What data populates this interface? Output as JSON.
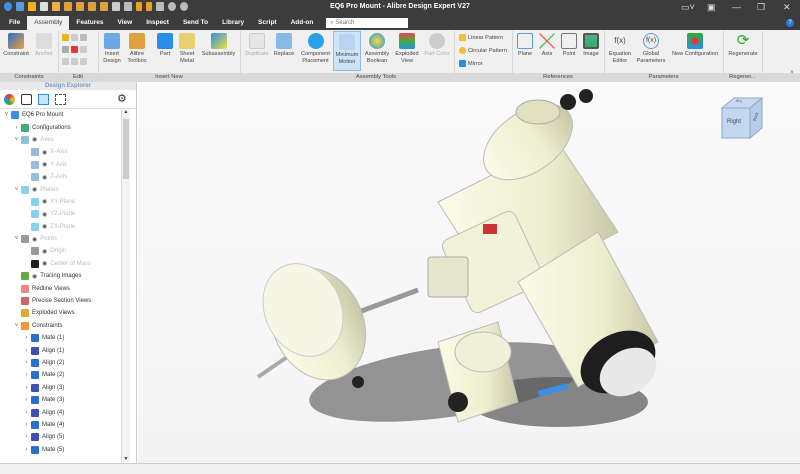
{
  "window": {
    "title": "EQ6 Pro Mount - Alibre Design Expert V27"
  },
  "tabs": [
    "File",
    "Assembly",
    "Features",
    "View",
    "Inspect",
    "Send To",
    "Library",
    "Script",
    "Add-on"
  ],
  "search": {
    "placeholder": "Search"
  },
  "ribbon": {
    "constraints": {
      "constraint": "Constraint",
      "anchor": "Anchor"
    },
    "insert": {
      "insert_design": "Insert Design",
      "alibre_toolbox": "Alibre Toolbox",
      "part": "Part",
      "sheet_metal": "Sheet Metal",
      "subassembly": "Subassembly"
    },
    "tools": {
      "duplicate": "Duplicate",
      "replace": "Replace",
      "component_placement": "Component Placement",
      "minimum_motion": "Minimum Motion",
      "assembly_boolean": "Assembly Boolean",
      "exploded_view": "Exploded View",
      "part_color": "Part Color",
      "linear_pattern": "Linear Pattern",
      "circular_pattern": "Circular Pattern",
      "mirror": "Mirror"
    },
    "references": {
      "plane": "Plane",
      "axis": "Axis",
      "point": "Point",
      "image": "Image"
    },
    "parameters": {
      "equation_editor": "Equation Editor",
      "global_parameters": "Global Parameters",
      "new_configuration": "New Configuration"
    },
    "regenerate": "Regenerate",
    "groups": {
      "constraints": "Constraints",
      "edit": "Edit",
      "insert_new": "Insert New",
      "assembly_tools": "Assembly Tools",
      "references": "References",
      "parameters": "Parameters",
      "regenerate": "Regener..."
    }
  },
  "explorer": {
    "title": "Design Explorer",
    "tree": [
      {
        "label": "EQ6 Pro Mount",
        "level": 0,
        "tw": "v",
        "dim": false,
        "icon": "#3a8ee6",
        "eye": false
      },
      {
        "label": "Configurations",
        "level": 1,
        "tw": ">",
        "dim": false,
        "icon": "#4a7",
        "eye": false
      },
      {
        "label": "Axes",
        "level": 1,
        "tw": "v",
        "dim": true,
        "icon": "#9bd",
        "eye": true
      },
      {
        "label": "X-Axis",
        "level": 2,
        "tw": "",
        "dim": true,
        "icon": "#9bd",
        "eye": true
      },
      {
        "label": "Y-Axis",
        "level": 2,
        "tw": "",
        "dim": true,
        "icon": "#9bd",
        "eye": true
      },
      {
        "label": "Z-Axis",
        "level": 2,
        "tw": "",
        "dim": true,
        "icon": "#9bd",
        "eye": true
      },
      {
        "label": "Planes",
        "level": 1,
        "tw": "v",
        "dim": true,
        "icon": "#8bd0f0",
        "eye": true
      },
      {
        "label": "XY-Plane",
        "level": 2,
        "tw": "",
        "dim": true,
        "icon": "#8bd0f0",
        "eye": true
      },
      {
        "label": "YZ-Plane",
        "level": 2,
        "tw": "",
        "dim": true,
        "icon": "#8bd0f0",
        "eye": true
      },
      {
        "label": "ZX-Plane",
        "level": 2,
        "tw": "",
        "dim": true,
        "icon": "#8bd0f0",
        "eye": true
      },
      {
        "label": "Points",
        "level": 1,
        "tw": "v",
        "dim": true,
        "icon": "#999",
        "eye": true
      },
      {
        "label": "Origin",
        "level": 2,
        "tw": "",
        "dim": true,
        "icon": "#999",
        "eye": true
      },
      {
        "label": "Center of Mass",
        "level": 2,
        "tw": "",
        "dim": true,
        "icon": "#222",
        "eye": true
      },
      {
        "label": "Tracing Images",
        "level": 1,
        "tw": "",
        "dim": false,
        "icon": "#6a4",
        "eye": true
      },
      {
        "label": "Redline Views",
        "level": 1,
        "tw": "",
        "dim": false,
        "icon": "#e88",
        "eye": false
      },
      {
        "label": "Precise Section Views",
        "level": 1,
        "tw": "",
        "dim": false,
        "icon": "#c66",
        "eye": false
      },
      {
        "label": "Exploded Views",
        "level": 1,
        "tw": "",
        "dim": false,
        "icon": "#da3",
        "eye": false
      },
      {
        "label": "Constraints",
        "level": 1,
        "tw": "v",
        "dim": false,
        "icon": "#e93",
        "eye": false
      },
      {
        "label": "Mate (1)",
        "level": 2,
        "tw": ">",
        "dim": false,
        "icon": "#2a6fc9",
        "eye": false
      },
      {
        "label": "Align (1)",
        "level": 2,
        "tw": ">",
        "dim": false,
        "icon": "#4050b0",
        "eye": false
      },
      {
        "label": "Align (2)",
        "level": 2,
        "tw": ">",
        "dim": false,
        "icon": "#2a6fc9",
        "eye": false
      },
      {
        "label": "Mate (2)",
        "level": 2,
        "tw": ">",
        "dim": false,
        "icon": "#2a6fc9",
        "eye": false
      },
      {
        "label": "Align (3)",
        "level": 2,
        "tw": ">",
        "dim": false,
        "icon": "#4050b0",
        "eye": false
      },
      {
        "label": "Mate (3)",
        "level": 2,
        "tw": ">",
        "dim": false,
        "icon": "#2a6fc9",
        "eye": false
      },
      {
        "label": "Align (4)",
        "level": 2,
        "tw": ">",
        "dim": false,
        "icon": "#4050b0",
        "eye": false
      },
      {
        "label": "Mate (4)",
        "level": 2,
        "tw": ">",
        "dim": false,
        "icon": "#2a6fc9",
        "eye": false
      },
      {
        "label": "Align (5)",
        "level": 2,
        "tw": ">",
        "dim": false,
        "icon": "#4050b0",
        "eye": false
      },
      {
        "label": "Mate (5)",
        "level": 2,
        "tw": ">",
        "dim": false,
        "icon": "#2a6fc9",
        "eye": false
      }
    ]
  },
  "viewcube": {
    "front": "Right",
    "top": "Top",
    "side": "Back"
  }
}
